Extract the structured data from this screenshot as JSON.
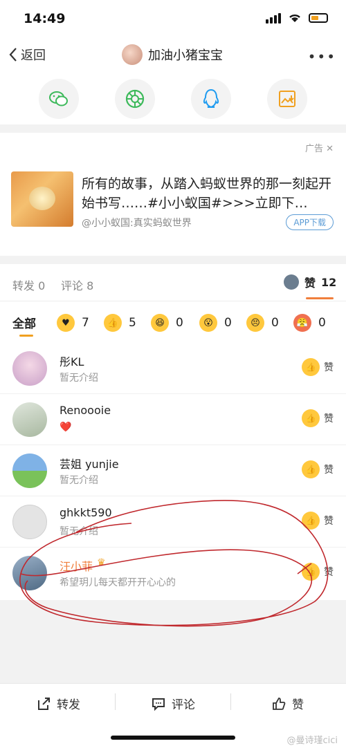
{
  "status": {
    "time": "14:49"
  },
  "nav": {
    "back_label": "返回",
    "title": "加油小猪宝宝",
    "more": "•••"
  },
  "ad": {
    "tag": "广告",
    "text": "所有的故事，从踏入蚂蚁世界的那一刻起开始书写……#小小蚁国#>>>立即下…",
    "source": "@小小蚁国:真实蚂蚁世界",
    "button": "APP下载"
  },
  "tabs": {
    "repost_label": "转发",
    "repost_count": "0",
    "comment_label": "评论",
    "comment_count": "8",
    "like_label": "赞",
    "like_count": "12"
  },
  "reactions": {
    "all_label": "全部",
    "items": [
      {
        "icon": "heart-emoji-icon",
        "count": "7"
      },
      {
        "icon": "thumbs-up-emoji-icon",
        "count": "5"
      },
      {
        "icon": "laugh-emoji-icon",
        "count": "0"
      },
      {
        "icon": "surprised-emoji-icon",
        "count": "0"
      },
      {
        "icon": "sad-emoji-icon",
        "count": "0"
      },
      {
        "icon": "angry-emoji-icon",
        "count": "0"
      }
    ]
  },
  "likers": [
    {
      "name": "彤KL",
      "intro": "暂无介绍",
      "like_label": "赞"
    },
    {
      "name": "Renoooie",
      "intro": "❤️",
      "like_label": "赞"
    },
    {
      "name": "芸姐 yunjie",
      "intro": "暂无介绍",
      "like_label": "赞"
    },
    {
      "name": "ghkkt590",
      "intro": "暂无介绍",
      "like_label": "赞"
    },
    {
      "name": "汪小菲",
      "intro": "希望玥儿每天都开开心心的",
      "like_label": "赞"
    }
  ],
  "bottom": {
    "repost": "转发",
    "comment": "评论",
    "like": "赞"
  },
  "watermark": "@曼诗瑾cici",
  "colors": {
    "accent": "#f07f3c",
    "highlight_name": "#f07f3c",
    "annotation": "#c0282d"
  }
}
